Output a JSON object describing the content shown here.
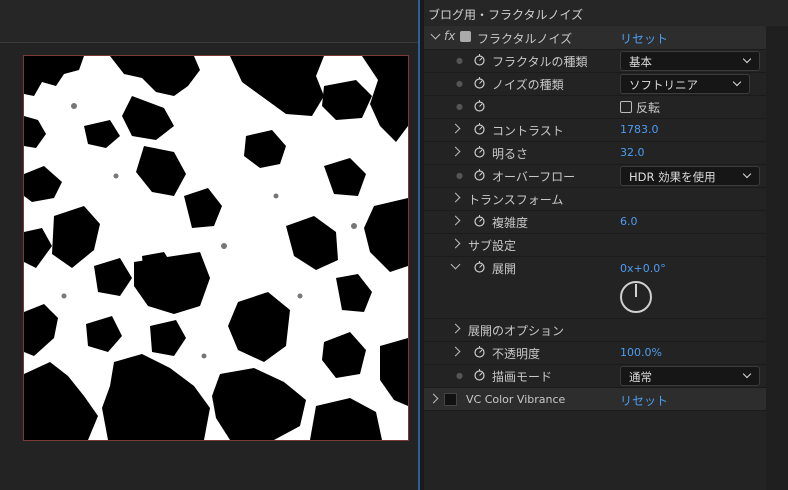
{
  "panel": {
    "title": "ブログ用・フラクタルノイズ"
  },
  "effect": {
    "name": "フラクタルノイズ",
    "reset": "リセット",
    "fx_icon": "fx-icon"
  },
  "props": {
    "fractal_type": {
      "label": "フラクタルの種類",
      "value": "基本"
    },
    "noise_type": {
      "label": "ノイズの種類",
      "value": "ソフトリニア"
    },
    "invert": {
      "label": "反転"
    },
    "contrast": {
      "label": "コントラスト",
      "value": "1783.0"
    },
    "brightness": {
      "label": "明るさ",
      "value": "32.0"
    },
    "overflow": {
      "label": "オーバーフロー",
      "value": "HDR 効果を使用"
    },
    "transform": {
      "label": "トランスフォーム"
    },
    "complexity": {
      "label": "複雑度",
      "value": "6.0"
    },
    "sub": {
      "label": "サブ設定"
    },
    "evolution": {
      "label": "展開",
      "value": "0x+0.0°"
    },
    "evo_options": {
      "label": "展開のオプション"
    },
    "opacity": {
      "label": "不透明度",
      "value": "100.0%"
    },
    "blend": {
      "label": "描画モード",
      "value": "通常"
    }
  },
  "effect2": {
    "name": "VC Color Vibrance",
    "reset": "リセット"
  }
}
